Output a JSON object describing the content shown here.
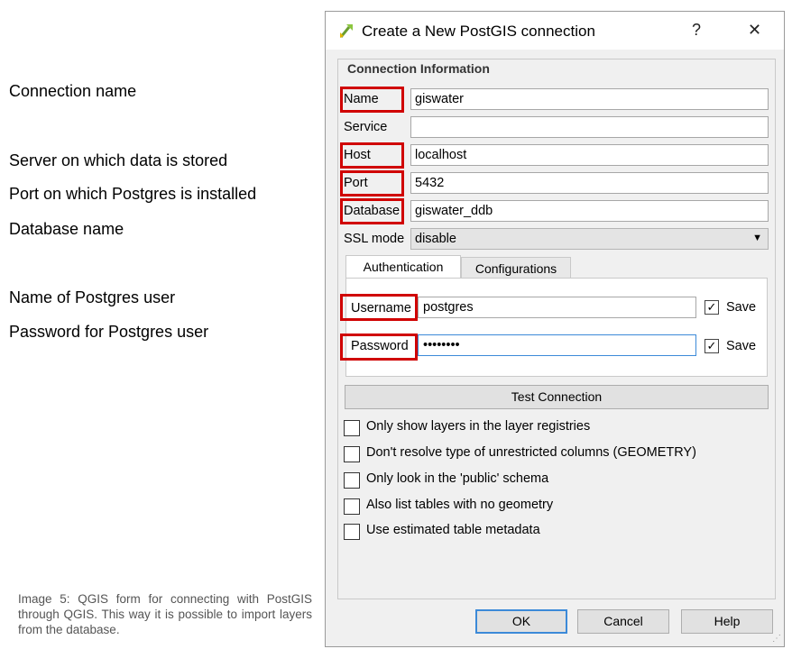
{
  "annotations": {
    "connection_name": "Connection name",
    "server": "Server on which data is stored",
    "port": "Port on which Postgres is installed",
    "database": "Database name",
    "user": "Name of Postgres user",
    "password": "Password for Postgres user"
  },
  "caption": "Image 5: QGIS form for connecting with PostGIS through QGIS. This way it is possible to import layers from the database.",
  "dialog": {
    "title": "Create a New PostGIS connection",
    "help_glyph": "?",
    "close_glyph": "✕",
    "group_title": "Connection Information",
    "fields": {
      "name": {
        "label": "Name",
        "value": "giswater"
      },
      "service": {
        "label": "Service",
        "value": ""
      },
      "host": {
        "label": "Host",
        "value": "localhost"
      },
      "port": {
        "label": "Port",
        "value": "5432"
      },
      "database": {
        "label": "Database",
        "value": "giswater_ddb"
      },
      "ssl": {
        "label": "SSL mode",
        "value": "disable"
      }
    },
    "tabs": {
      "authentication": "Authentication",
      "configurations": "Configurations"
    },
    "auth": {
      "username_label": "Username",
      "username_value": "postgres",
      "password_label": "Password",
      "password_value": "••••••••",
      "save_label": "Save"
    },
    "test_button": "Test Connection",
    "options": [
      "Only show layers in the layer registries",
      "Don't resolve type of unrestricted columns (GEOMETRY)",
      "Only look in the 'public' schema",
      "Also list tables with no geometry",
      "Use estimated table metadata"
    ],
    "buttons": {
      "ok": "OK",
      "cancel": "Cancel",
      "help": "Help"
    }
  },
  "colors": {
    "highlight": "#d00000",
    "focus": "#3c8ad8"
  }
}
